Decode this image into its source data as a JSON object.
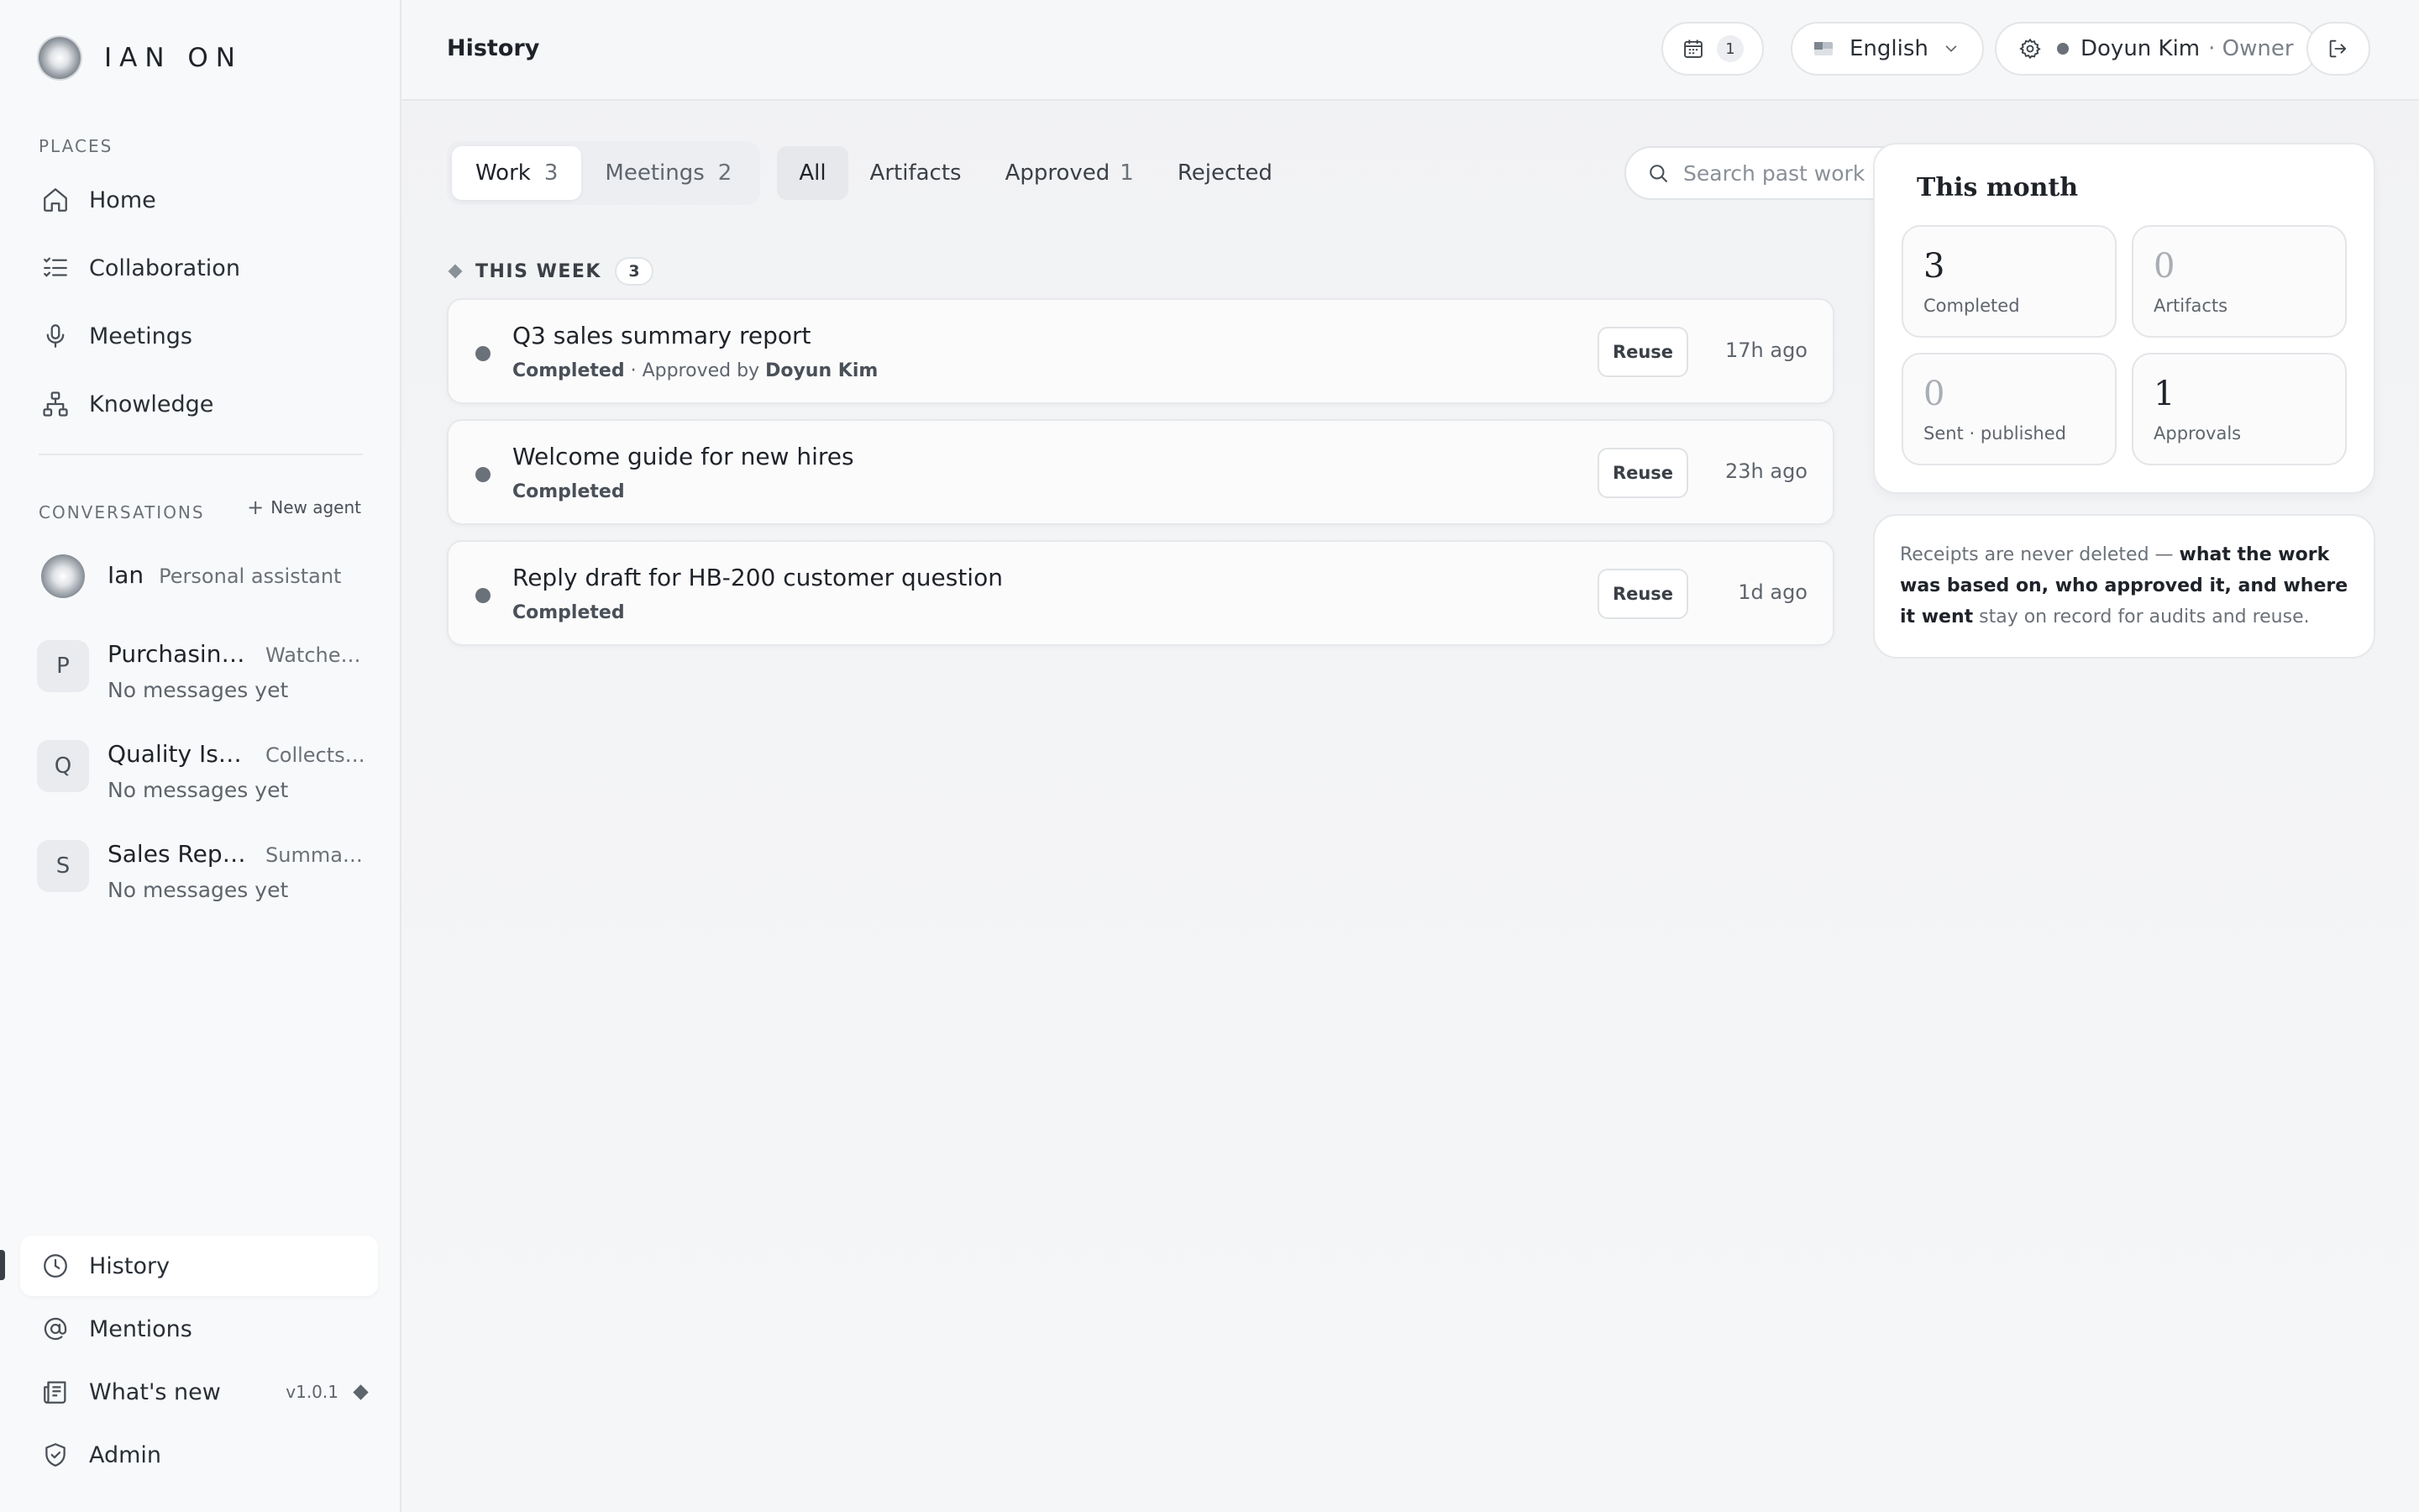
{
  "brand": {
    "name": "IAN ON"
  },
  "sidebar": {
    "places_label": "PLACES",
    "places": [
      {
        "label": "Home",
        "icon": "home-icon"
      },
      {
        "label": "Collaboration",
        "icon": "checklist-icon"
      },
      {
        "label": "Meetings",
        "icon": "microphone-icon"
      },
      {
        "label": "Knowledge",
        "icon": "hierarchy-icon"
      }
    ],
    "conversations_label": "CONVERSATIONS",
    "new_agent_label": "New agent",
    "conversations": [
      {
        "avatar": "",
        "name": "Ian",
        "desc": "Personal assistant",
        "sub": ""
      },
      {
        "avatar": "P",
        "name": "Purchasing...",
        "desc": "Watches ...",
        "sub": "No messages yet"
      },
      {
        "avatar": "Q",
        "name": "Quality Iss...",
        "desc": "Collects ...",
        "sub": "No messages yet"
      },
      {
        "avatar": "S",
        "name": "Sales Repo...",
        "desc": "Summari...",
        "sub": "No messages yet"
      }
    ],
    "bottom": [
      {
        "label": "History",
        "icon": "clock-icon",
        "active": true
      },
      {
        "label": "Mentions",
        "icon": "at-icon"
      },
      {
        "label": "What's new",
        "icon": "newspaper-icon",
        "version": "v1.0.1"
      },
      {
        "label": "Admin",
        "icon": "shield-check-icon"
      }
    ]
  },
  "header": {
    "title": "History",
    "calendar_count": "1",
    "language": "English",
    "user": "Doyun Kim",
    "role": "· Owner"
  },
  "tabs": {
    "segments": [
      {
        "label": "Work",
        "count": "3",
        "active": true
      },
      {
        "label": "Meetings",
        "count": "2"
      }
    ],
    "filters": [
      {
        "label": "All",
        "active": true
      },
      {
        "label": "Artifacts"
      },
      {
        "label": "Approved",
        "count": "1"
      },
      {
        "label": "Rejected"
      }
    ]
  },
  "search": {
    "placeholder": "Search past work · approvals",
    "value": ""
  },
  "section": {
    "label": "THIS WEEK",
    "count": "3"
  },
  "items": [
    {
      "title": "Q3 sales summary report",
      "status": "Completed",
      "approved_prefix": " · Approved by ",
      "approved_by": "Doyun Kim",
      "reuse": "Reuse",
      "ago": "17h ago"
    },
    {
      "title": "Welcome guide for new hires",
      "status": "Completed",
      "approved_prefix": "",
      "approved_by": "",
      "reuse": "Reuse",
      "ago": "23h ago"
    },
    {
      "title": "Reply draft for HB-200 customer question",
      "status": "Completed",
      "approved_prefix": "",
      "approved_by": "",
      "reuse": "Reuse",
      "ago": "1d ago"
    }
  ],
  "month": {
    "title": "This month",
    "stats": [
      {
        "value": "3",
        "label": "Completed"
      },
      {
        "value": "0",
        "label": "Artifacts"
      },
      {
        "value": "0",
        "label": "Sent · published"
      },
      {
        "value": "1",
        "label": "Approvals"
      }
    ]
  },
  "note": {
    "pre": "Receipts are never deleted — ",
    "bold": "what the work was based on, who approved it, and where it went",
    "post": " stay on record for audits and reuse."
  }
}
